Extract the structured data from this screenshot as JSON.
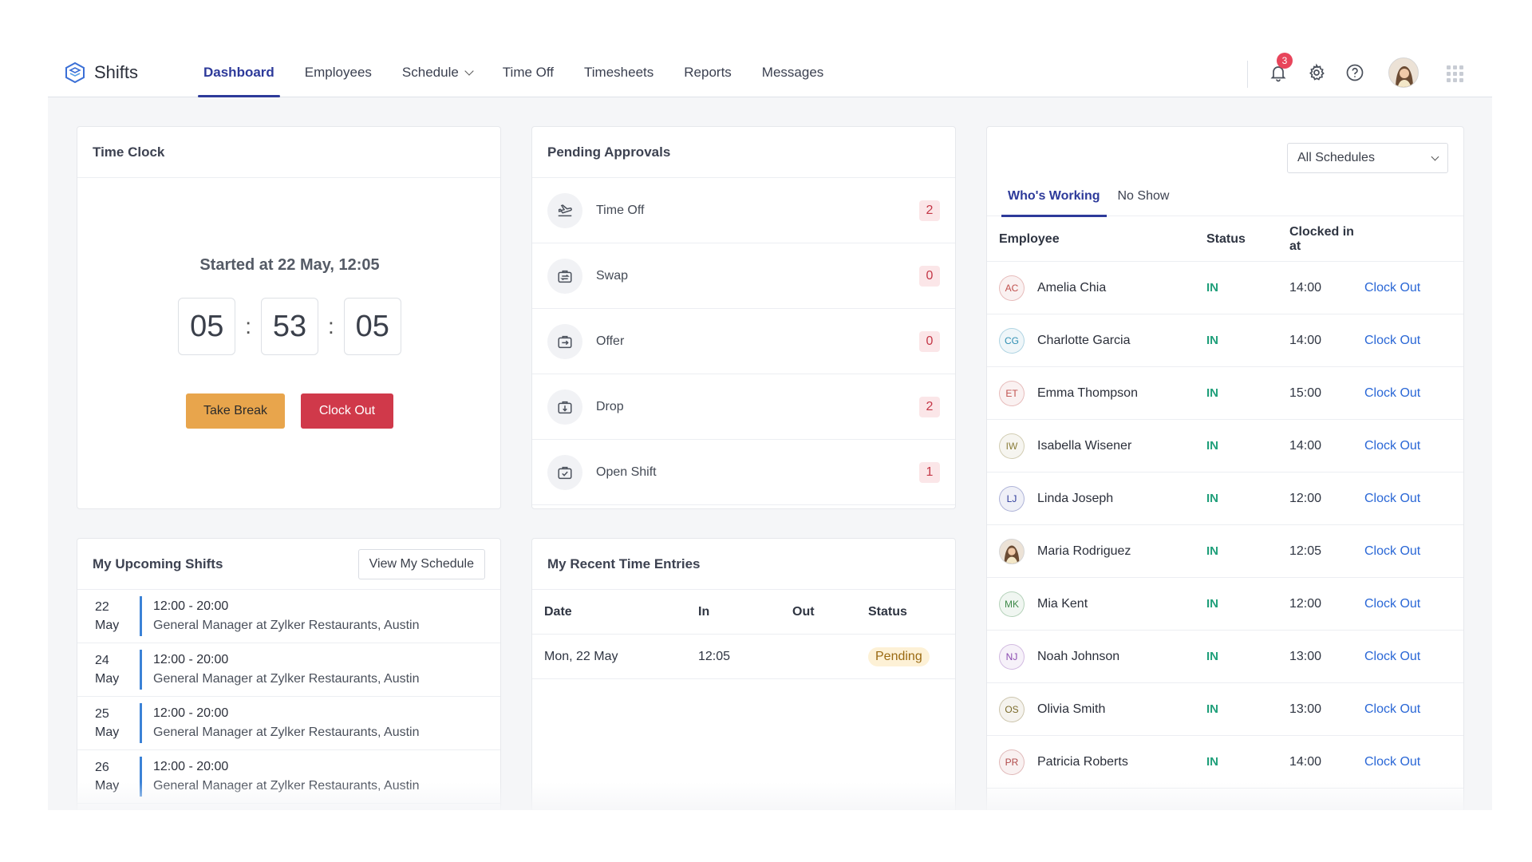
{
  "app": {
    "name": "Shifts"
  },
  "nav": {
    "items": [
      {
        "label": "Dashboard",
        "active": true
      },
      {
        "label": "Employees"
      },
      {
        "label": "Schedule",
        "has_caret": true
      },
      {
        "label": "Time Off"
      },
      {
        "label": "Timesheets"
      },
      {
        "label": "Reports"
      },
      {
        "label": "Messages"
      }
    ]
  },
  "topbar": {
    "notification_count": "3"
  },
  "colors": {
    "accent": "#2d3a9a",
    "take_break": "#e8a54c",
    "clock_out": "#d0394a",
    "status_in": "#1f9f7a",
    "link": "#2a67d6"
  },
  "time_clock": {
    "title": "Time Clock",
    "started": "Started at 22 May, 12:05",
    "hours": "05",
    "minutes": "53",
    "seconds": "05",
    "take_break_label": "Take Break",
    "clock_out_label": "Clock Out"
  },
  "pending_approvals": {
    "title": "Pending Approvals",
    "items": [
      {
        "label": "Time Off",
        "count": "2",
        "icon": "plane-departure-icon"
      },
      {
        "label": "Swap",
        "count": "0",
        "icon": "swap-briefcase-icon"
      },
      {
        "label": "Offer",
        "count": "0",
        "icon": "offer-briefcase-icon"
      },
      {
        "label": "Drop",
        "count": "2",
        "icon": "drop-briefcase-icon"
      },
      {
        "label": "Open Shift",
        "count": "1",
        "icon": "open-shift-briefcase-icon"
      }
    ]
  },
  "whos_working": {
    "schedule_filter": "All Schedules",
    "tabs": [
      {
        "label": "Who's Working",
        "active": true
      },
      {
        "label": "No Show"
      }
    ],
    "columns": {
      "employee": "Employee",
      "status": "Status",
      "clocked_in": "Clocked in at"
    },
    "rows": [
      {
        "initials": "AC",
        "name": "Amelia Chia",
        "status": "IN",
        "time": "14:00",
        "action": "Clock Out",
        "avatar_color": "#c0504d"
      },
      {
        "initials": "CG",
        "name": "Charlotte Garcia",
        "status": "IN",
        "time": "14:00",
        "action": "Clock Out",
        "avatar_color": "#2f8fb3"
      },
      {
        "initials": "ET",
        "name": "Emma Thompson",
        "status": "IN",
        "time": "15:00",
        "action": "Clock Out",
        "avatar_color": "#c0504d"
      },
      {
        "initials": "IW",
        "name": "Isabella Wisener",
        "status": "IN",
        "time": "14:00",
        "action": "Clock Out",
        "avatar_color": "#8a7d3a"
      },
      {
        "initials": "LJ",
        "name": "Linda Joseph",
        "status": "IN",
        "time": "12:00",
        "action": "Clock Out",
        "avatar_color": "#2d3a9a"
      },
      {
        "initials": "",
        "name": "Maria Rodriguez",
        "status": "IN",
        "time": "12:05",
        "action": "Clock Out",
        "avatar_color": "photo"
      },
      {
        "initials": "MK",
        "name": "Mia Kent",
        "status": "IN",
        "time": "12:00",
        "action": "Clock Out",
        "avatar_color": "#3f8a4a"
      },
      {
        "initials": "NJ",
        "name": "Noah Johnson",
        "status": "IN",
        "time": "13:00",
        "action": "Clock Out",
        "avatar_color": "#8a4ab0"
      },
      {
        "initials": "OS",
        "name": "Olivia Smith",
        "status": "IN",
        "time": "13:00",
        "action": "Clock Out",
        "avatar_color": "#7a6a2a"
      },
      {
        "initials": "PR",
        "name": "Patricia Roberts",
        "status": "IN",
        "time": "14:00",
        "action": "Clock Out",
        "avatar_color": "#b04a4a"
      }
    ]
  },
  "upcoming_shifts": {
    "title": "My Upcoming Shifts",
    "view_label": "View My Schedule",
    "items": [
      {
        "day": "22",
        "month": "May",
        "time": "12:00 - 20:00",
        "role": "General Manager at Zylker Restaurants, Austin"
      },
      {
        "day": "24",
        "month": "May",
        "time": "12:00 - 20:00",
        "role": "General Manager at Zylker Restaurants, Austin"
      },
      {
        "day": "25",
        "month": "May",
        "time": "12:00 - 20:00",
        "role": "General Manager at Zylker Restaurants, Austin"
      },
      {
        "day": "26",
        "month": "May",
        "time": "12:00 - 20:00",
        "role": "General Manager at Zylker Restaurants, Austin"
      }
    ]
  },
  "recent_entries": {
    "title": "My Recent Time Entries",
    "columns": {
      "date": "Date",
      "in": "In",
      "out": "Out",
      "status": "Status"
    },
    "rows": [
      {
        "date": "Mon, 22 May",
        "in": "12:05",
        "out": "",
        "status": "Pending"
      }
    ]
  }
}
